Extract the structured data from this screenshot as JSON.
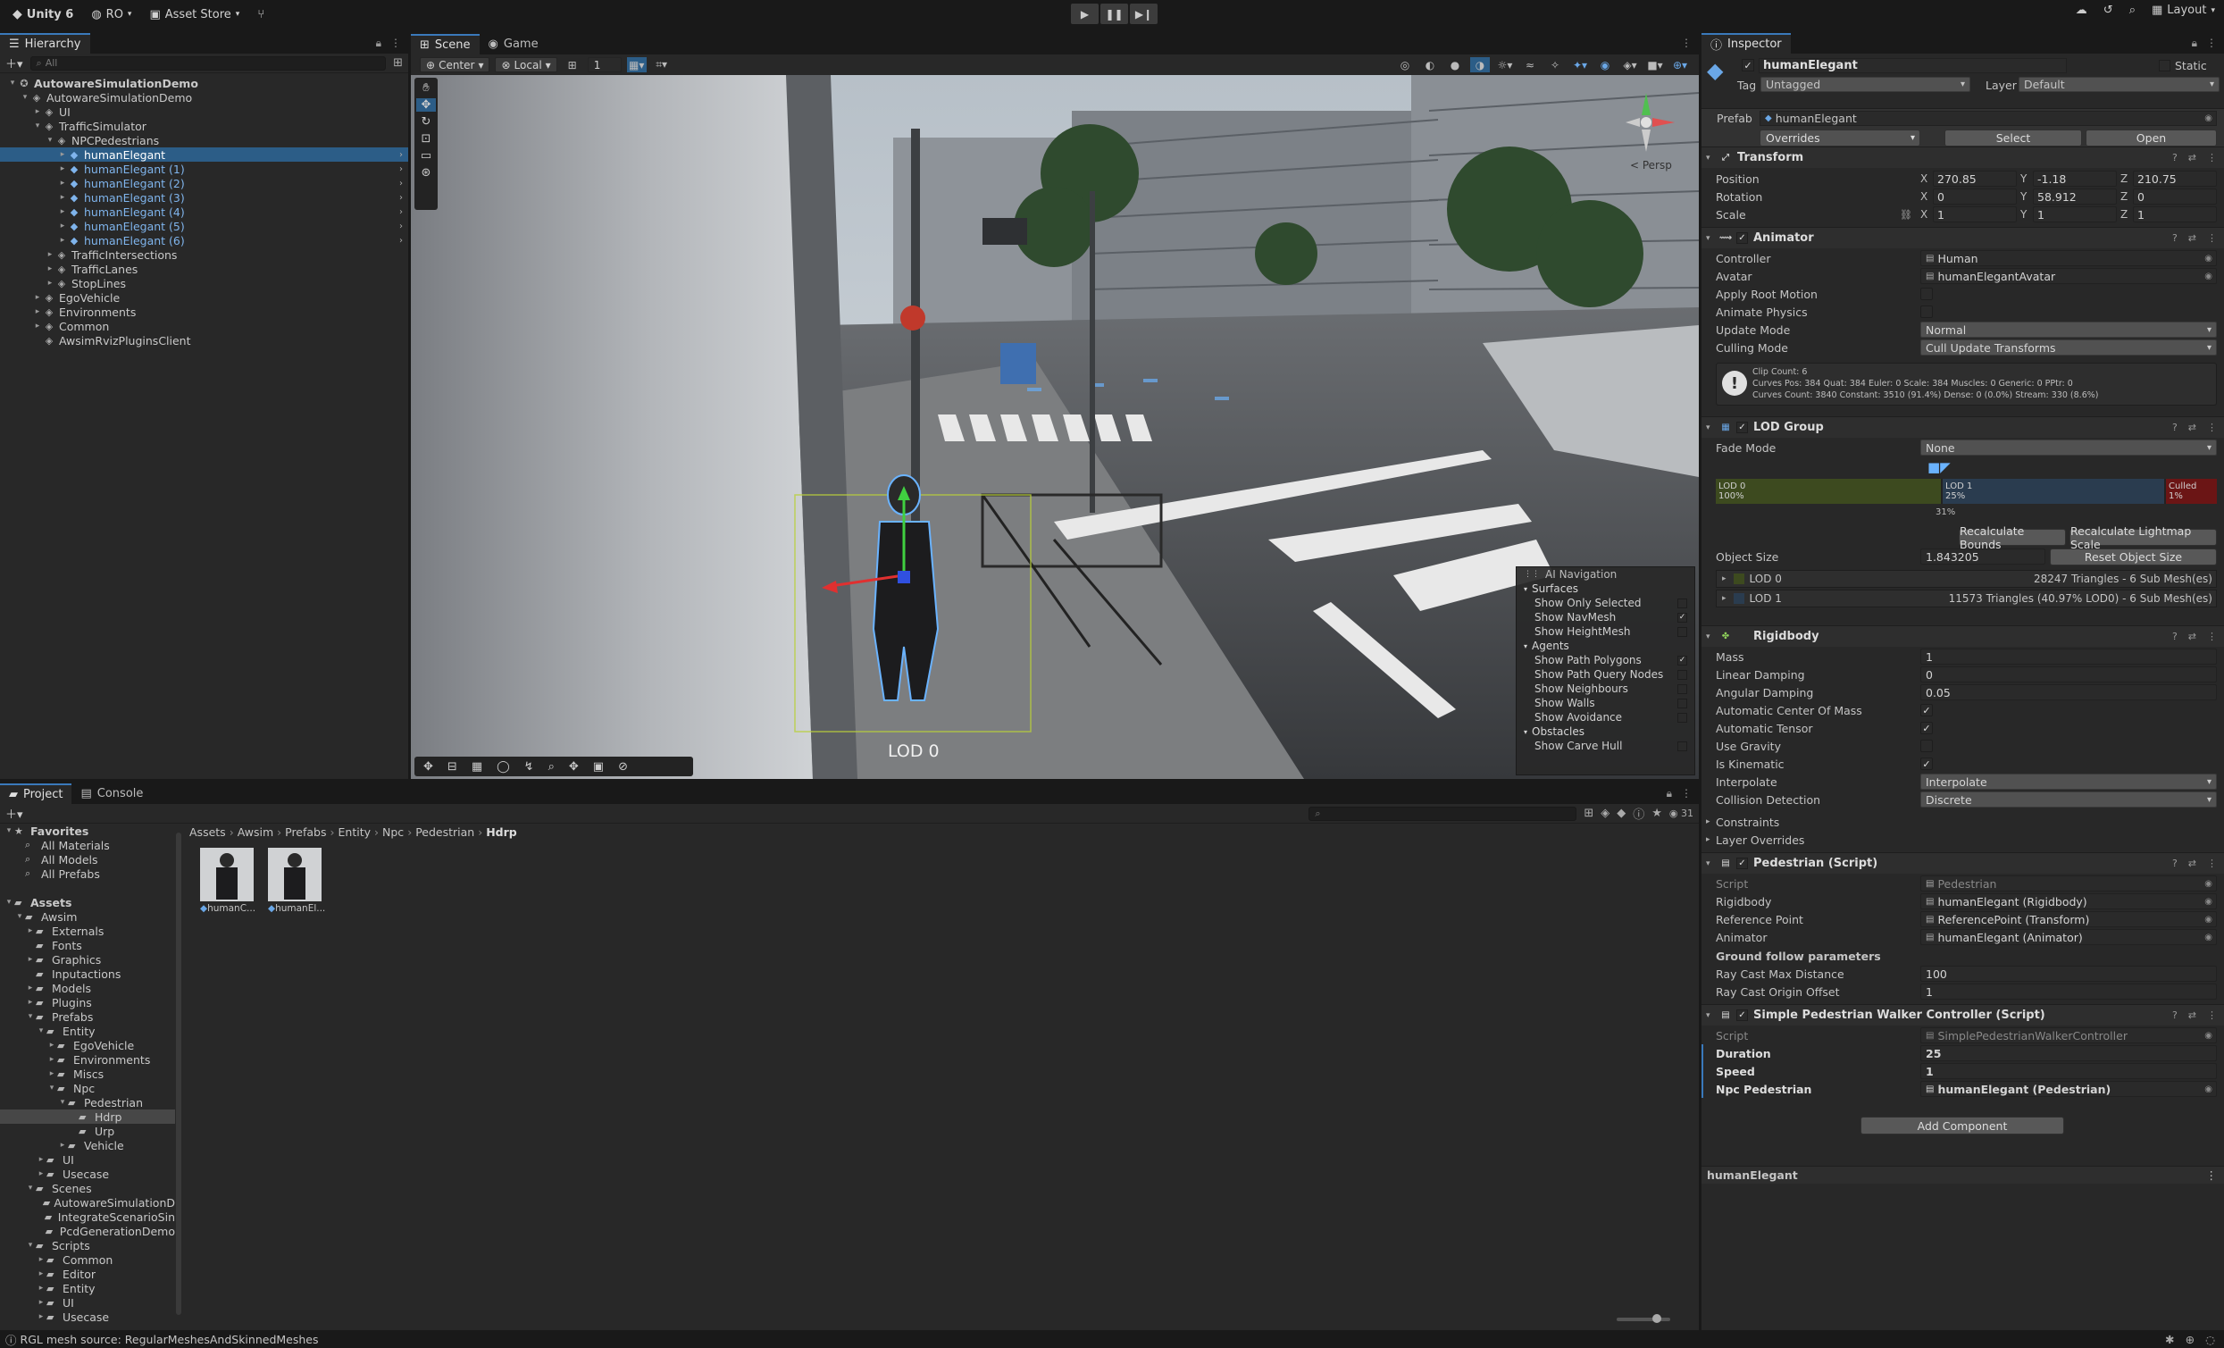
{
  "toolbar": {
    "unity_label": "Unity 6",
    "account": "RO",
    "asset_store": "Asset Store",
    "layout": "Layout"
  },
  "hierarchy": {
    "tab": "Hierarchy",
    "search_placeholder": "All",
    "rows": [
      {
        "label": "AutowareSimulationDemo",
        "indent": 0,
        "arrow": "▾",
        "icon": "✪",
        "bold": true
      },
      {
        "label": "AutowareSimulationDemo",
        "indent": 1,
        "arrow": "▾",
        "icon": "◈"
      },
      {
        "label": "UI",
        "indent": 2,
        "arrow": "▸",
        "icon": "◈"
      },
      {
        "label": "TrafficSimulator",
        "indent": 2,
        "arrow": "▾",
        "icon": "◈"
      },
      {
        "label": "NPCPedestrians",
        "indent": 3,
        "arrow": "▾",
        "icon": "◈"
      },
      {
        "label": "humanElegant",
        "indent": 4,
        "arrow": "▸",
        "icon": "◆",
        "blue": true,
        "selected": true
      },
      {
        "label": "humanElegant (1)",
        "indent": 4,
        "arrow": "▸",
        "icon": "◆",
        "blue": true
      },
      {
        "label": "humanElegant (2)",
        "indent": 4,
        "arrow": "▸",
        "icon": "◆",
        "blue": true
      },
      {
        "label": "humanElegant (3)",
        "indent": 4,
        "arrow": "▸",
        "icon": "◆",
        "blue": true
      },
      {
        "label": "humanElegant (4)",
        "indent": 4,
        "arrow": "▸",
        "icon": "◆",
        "blue": true
      },
      {
        "label": "humanElegant (5)",
        "indent": 4,
        "arrow": "▸",
        "icon": "◆",
        "blue": true
      },
      {
        "label": "humanElegant (6)",
        "indent": 4,
        "arrow": "▸",
        "icon": "◆",
        "blue": true
      },
      {
        "label": "TrafficIntersections",
        "indent": 3,
        "arrow": "▸",
        "icon": "◈"
      },
      {
        "label": "TrafficLanes",
        "indent": 3,
        "arrow": "▸",
        "icon": "◈"
      },
      {
        "label": "StopLines",
        "indent": 3,
        "arrow": "▸",
        "icon": "◈"
      },
      {
        "label": "EgoVehicle",
        "indent": 2,
        "arrow": "▸",
        "icon": "◈"
      },
      {
        "label": "Environments",
        "indent": 2,
        "arrow": "▸",
        "icon": "◈"
      },
      {
        "label": "Common",
        "indent": 2,
        "arrow": "▸",
        "icon": "◈"
      },
      {
        "label": "AwsimRvizPluginsClient",
        "indent": 2,
        "arrow": "",
        "icon": "◈"
      }
    ]
  },
  "scene": {
    "tabs": [
      "Scene",
      "Game"
    ],
    "pivot": "Center",
    "space": "Local",
    "snap": "1",
    "persp": "< Persp",
    "lod_label": "LOD 0",
    "ai_nav": {
      "title": "AI Navigation",
      "groups": [
        {
          "name": "Surfaces",
          "items": [
            {
              "label": "Show Only Selected",
              "checked": false
            },
            {
              "label": "Show NavMesh",
              "checked": true
            },
            {
              "label": "Show HeightMesh",
              "checked": false
            }
          ]
        },
        {
          "name": "Agents",
          "items": [
            {
              "label": "Show Path Polygons",
              "checked": true
            },
            {
              "label": "Show Path Query Nodes",
              "checked": false
            },
            {
              "label": "Show Neighbours",
              "checked": false
            },
            {
              "label": "Show Walls",
              "checked": false
            },
            {
              "label": "Show Avoidance",
              "checked": false
            }
          ]
        },
        {
          "name": "Obstacles",
          "items": [
            {
              "label": "Show Carve Hull",
              "checked": false
            }
          ]
        }
      ]
    }
  },
  "inspector": {
    "tab": "Inspector",
    "object_name": "humanElegant",
    "static_label": "Static",
    "tag_label": "Tag",
    "tag": "Untagged",
    "layer_label": "Layer",
    "layer": "Default",
    "prefab_label": "Prefab",
    "prefab": "humanElegant",
    "overrides": "Overrides",
    "select": "Select",
    "open": "Open",
    "transform": {
      "title": "Transform",
      "position_label": "Position",
      "position": [
        "270.85",
        "-1.18",
        "210.75"
      ],
      "rotation_label": "Rotation",
      "rotation": [
        "0",
        "58.912",
        "0"
      ],
      "scale_label": "Scale",
      "scale": [
        "1",
        "1",
        "1"
      ]
    },
    "animator": {
      "title": "Animator",
      "rows": [
        {
          "label": "Controller",
          "value": "Human",
          "kind": "obj"
        },
        {
          "label": "Avatar",
          "value": "humanElegantAvatar",
          "kind": "obj"
        },
        {
          "label": "Apply Root Motion",
          "checked": false,
          "kind": "cb"
        },
        {
          "label": "Animate Physics",
          "checked": false,
          "kind": "cb"
        },
        {
          "label": "Update Mode",
          "value": "Normal",
          "kind": "dd"
        },
        {
          "label": "Culling Mode",
          "value": "Cull Update Transforms",
          "kind": "dd"
        }
      ],
      "info": [
        "Clip Count: 6",
        "Curves Pos: 384 Quat: 384 Euler: 0 Scale: 384 Muscles: 0 Generic: 0 PPtr: 0",
        "Curves Count: 3840 Constant: 3510 (91.4%) Dense: 0 (0.0%) Stream: 330 (8.6%)"
      ]
    },
    "lod_group": {
      "title": "LOD Group",
      "fade_label": "Fade Mode",
      "fade": "None",
      "lod0": "LOD 0",
      "lod0_pct": "100%",
      "lod1": "LOD 1",
      "lod1_pct": "25%",
      "culled": "Culled",
      "culled_pct": "1%",
      "marker": "31%",
      "recalc_bounds": "Recalculate Bounds",
      "recalc_lightmap": "Recalculate Lightmap Scale",
      "object_size_label": "Object Size",
      "object_size": "1.843205",
      "reset_size": "Reset Object Size",
      "lod0_row": "LOD 0",
      "lod0_info": "28247 Triangles  - 6 Sub Mesh(es)",
      "lod1_row": "LOD 1",
      "lod1_info": "11573 Triangles (40.97% LOD0) - 6 Sub Mesh(es)"
    },
    "rigidbody": {
      "title": "Rigidbody",
      "rows": [
        {
          "label": "Mass",
          "value": "1",
          "kind": "val"
        },
        {
          "label": "Linear Damping",
          "value": "0",
          "kind": "val"
        },
        {
          "label": "Angular Damping",
          "value": "0.05",
          "kind": "val"
        },
        {
          "label": "Automatic Center Of Mass",
          "checked": true,
          "kind": "cb"
        },
        {
          "label": "Automatic Tensor",
          "checked": true,
          "kind": "cb"
        },
        {
          "label": "Use Gravity",
          "checked": false,
          "kind": "cb"
        },
        {
          "label": "Is Kinematic",
          "checked": true,
          "kind": "cb"
        },
        {
          "label": "Interpolate",
          "value": "Interpolate",
          "kind": "dd"
        },
        {
          "label": "Collision Detection",
          "value": "Discrete",
          "kind": "dd"
        }
      ],
      "constraints": "Constraints",
      "layer_overrides": "Layer Overrides"
    },
    "pedestrian": {
      "title": "Pedestrian (Script)",
      "rows": [
        {
          "label": "Script",
          "value": "Pedestrian",
          "kind": "obj",
          "dim": true
        },
        {
          "label": "Rigidbody",
          "value": "humanElegant (Rigidbody)",
          "kind": "obj"
        },
        {
          "label": "Reference Point",
          "value": "ReferencePoint (Transform)",
          "kind": "obj"
        },
        {
          "label": "Animator",
          "value": "humanElegant (Animator)",
          "kind": "obj"
        }
      ],
      "ground_header": "Ground follow parameters",
      "ray_dist_label": "Ray Cast Max Distance",
      "ray_dist": "100",
      "ray_offset_label": "Ray Cast Origin Offset",
      "ray_offset": "1"
    },
    "walker": {
      "title": "Simple Pedestrian Walker Controller (Script)",
      "script_label": "Script",
      "script": "SimplePedestrianWalkerController",
      "duration_label": "Duration",
      "duration": "25",
      "speed_label": "Speed",
      "speed": "1",
      "npc_label": "Npc Pedestrian",
      "npc": "humanElegant (Pedestrian)"
    },
    "add_component": "Add Component",
    "footer_name": "humanElegant"
  },
  "project": {
    "tabs": [
      "Project",
      "Console"
    ],
    "hidden_count": "31",
    "breadcrumb": [
      "Assets",
      "Awsim",
      "Prefabs",
      "Entity",
      "Npc",
      "Pedestrian",
      "Hdrp"
    ],
    "assets": [
      "humanC...",
      "humanEl..."
    ],
    "tree": [
      {
        "label": "Favorites",
        "indent": 0,
        "arrow": "▾",
        "icon": "★",
        "bold": true
      },
      {
        "label": "All Materials",
        "indent": 1,
        "arrow": "",
        "icon": "⌕"
      },
      {
        "label": "All Models",
        "indent": 1,
        "arrow": "",
        "icon": "⌕"
      },
      {
        "label": "All Prefabs",
        "indent": 1,
        "arrow": "",
        "icon": "⌕"
      },
      {
        "label": "",
        "indent": 0,
        "arrow": "",
        "icon": ""
      },
      {
        "label": "Assets",
        "indent": 0,
        "arrow": "▾",
        "icon": "▰",
        "bold": true
      },
      {
        "label": "Awsim",
        "indent": 1,
        "arrow": "▾",
        "icon": "▰"
      },
      {
        "label": "Externals",
        "indent": 2,
        "arrow": "▸",
        "icon": "▰"
      },
      {
        "label": "Fonts",
        "indent": 2,
        "arrow": "",
        "icon": "▰"
      },
      {
        "label": "Graphics",
        "indent": 2,
        "arrow": "▸",
        "icon": "▰"
      },
      {
        "label": "Inputactions",
        "indent": 2,
        "arrow": "",
        "icon": "▰"
      },
      {
        "label": "Models",
        "indent": 2,
        "arrow": "▸",
        "icon": "▰"
      },
      {
        "label": "Plugins",
        "indent": 2,
        "arrow": "▸",
        "icon": "▰"
      },
      {
        "label": "Prefabs",
        "indent": 2,
        "arrow": "▾",
        "icon": "▰"
      },
      {
        "label": "Entity",
        "indent": 3,
        "arrow": "▾",
        "icon": "▰"
      },
      {
        "label": "EgoVehicle",
        "indent": 4,
        "arrow": "▸",
        "icon": "▰"
      },
      {
        "label": "Environments",
        "indent": 4,
        "arrow": "▸",
        "icon": "▰"
      },
      {
        "label": "Miscs",
        "indent": 4,
        "arrow": "▸",
        "icon": "▰"
      },
      {
        "label": "Npc",
        "indent": 4,
        "arrow": "▾",
        "icon": "▰"
      },
      {
        "label": "Pedestrian",
        "indent": 5,
        "arrow": "▾",
        "icon": "▰"
      },
      {
        "label": "Hdrp",
        "indent": 6,
        "arrow": "",
        "icon": "▰",
        "selected": true
      },
      {
        "label": "Urp",
        "indent": 6,
        "arrow": "",
        "icon": "▰"
      },
      {
        "label": "Vehicle",
        "indent": 5,
        "arrow": "▸",
        "icon": "▰"
      },
      {
        "label": "UI",
        "indent": 3,
        "arrow": "▸",
        "icon": "▰"
      },
      {
        "label": "Usecase",
        "indent": 3,
        "arrow": "▸",
        "icon": "▰"
      },
      {
        "label": "Scenes",
        "indent": 2,
        "arrow": "▾",
        "icon": "▰"
      },
      {
        "label": "AutowareSimulationD",
        "indent": 3,
        "arrow": "",
        "icon": "▰"
      },
      {
        "label": "IntegrateScenarioSin",
        "indent": 3,
        "arrow": "",
        "icon": "▰"
      },
      {
        "label": "PcdGenerationDemo",
        "indent": 3,
        "arrow": "",
        "icon": "▰"
      },
      {
        "label": "Scripts",
        "indent": 2,
        "arrow": "▾",
        "icon": "▰"
      },
      {
        "label": "Common",
        "indent": 3,
        "arrow": "▸",
        "icon": "▰"
      },
      {
        "label": "Editor",
        "indent": 3,
        "arrow": "▸",
        "icon": "▰"
      },
      {
        "label": "Entity",
        "indent": 3,
        "arrow": "▸",
        "icon": "▰"
      },
      {
        "label": "UI",
        "indent": 3,
        "arrow": "▸",
        "icon": "▰"
      },
      {
        "label": "Usecase",
        "indent": 3,
        "arrow": "▸",
        "icon": "▰"
      }
    ]
  },
  "status": {
    "text": "RGL mesh source: RegularMeshesAndSkinnedMeshes"
  }
}
